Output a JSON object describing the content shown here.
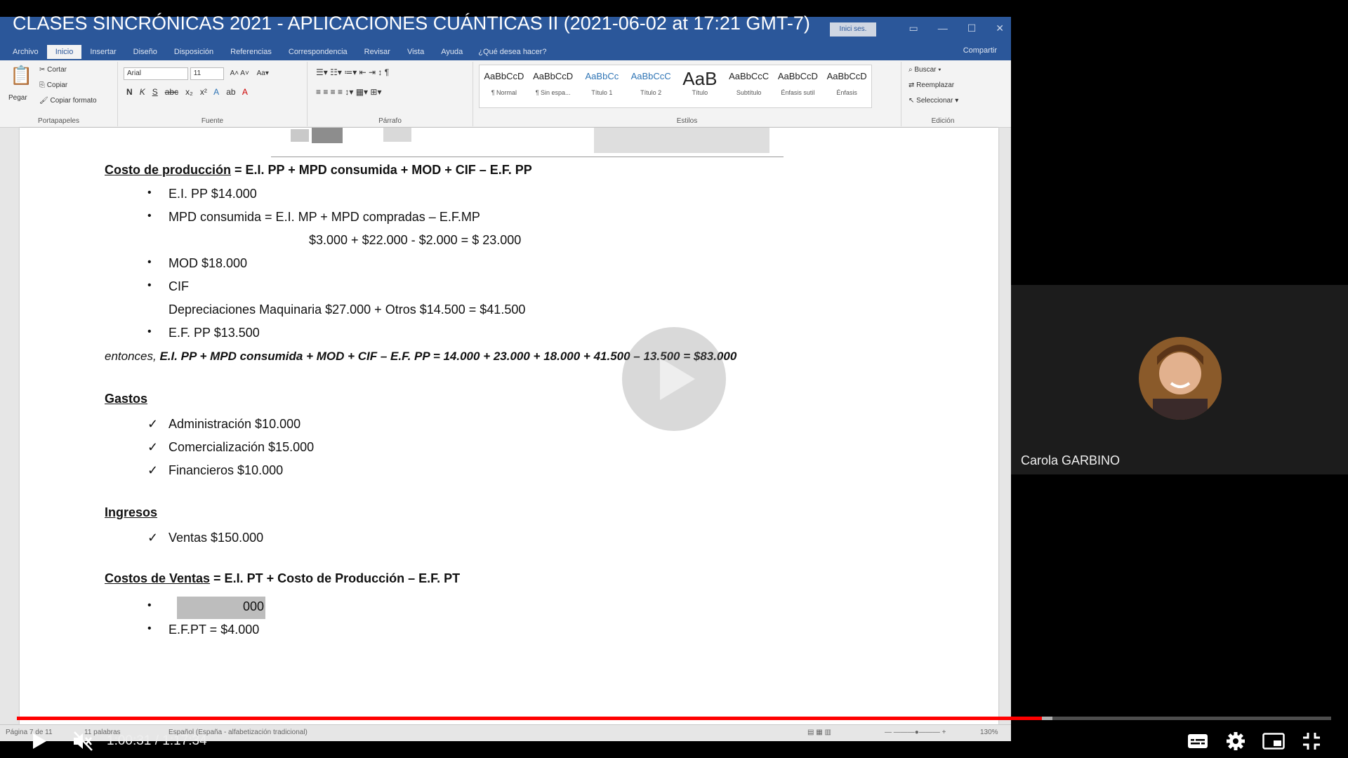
{
  "video": {
    "title": "CLASES SINCRÓNICAS 2021 - APLICACIONES CUÁNTICAS II (2021-06-02 at 17:21 GMT-7)",
    "time_current": "1:00:31",
    "time_separator": "/",
    "time_total": "1:17:34",
    "progress_fraction": 0.78,
    "buffer_fraction": 0.788,
    "accent_color": "#ff0000"
  },
  "participant": {
    "name": "Carola GARBINO"
  },
  "word": {
    "signin_label": "Inici ses.",
    "tabs": [
      "Archivo",
      "Inicio",
      "Insertar",
      "Diseño",
      "Disposición",
      "Referencias",
      "Correspondencia",
      "Revisar",
      "Vista",
      "Ayuda"
    ],
    "active_tab": "Inicio",
    "tellme": "¿Qué desea hacer?",
    "share": "Compartir",
    "clipboard": {
      "paste": "Pegar",
      "cut": "Cortar",
      "copy": "Copiar",
      "format": "Copiar formato",
      "group": "Portapapeles"
    },
    "font": {
      "name": "Arial",
      "size": "11",
      "group": "Fuente"
    },
    "paragraph_group": "Párrafo",
    "styles_group": "Estilos",
    "styles": [
      {
        "sample": "AaBbCcD",
        "name": "¶ Normal"
      },
      {
        "sample": "AaBbCcD",
        "name": "¶ Sin espa..."
      },
      {
        "sample": "AaBbCc",
        "name": "Título 1"
      },
      {
        "sample": "AaBbCcC",
        "name": "Título 2"
      },
      {
        "sample": "AaB",
        "name": "Título"
      },
      {
        "sample": "AaBbCcC",
        "name": "Subtítulo"
      },
      {
        "sample": "AaBbCcD",
        "name": "Énfasis sutil"
      },
      {
        "sample": "AaBbCcD",
        "name": "Énfasis"
      }
    ],
    "editing": {
      "find": "Buscar",
      "replace": "Reemplazar",
      "select": "Seleccionar",
      "group": "Edición"
    },
    "status": {
      "page": "Página 7 de 11",
      "words": "11 palabras",
      "language": "Español (España - alfabetización tradicional)",
      "zoom": "130%"
    }
  },
  "document": {
    "cost_heading_label": "Costo de producción",
    "cost_heading_rest": " = E.I. PP + MPD consumida + MOD + CIF – E.F. PP",
    "cost_items": {
      "ei": "E.I. PP $14.000",
      "mpd": "MPD consumida = E.I. MP + MPD compradas – E.F.MP",
      "mpd_calc": "$3.000 + $22.000 - $2.000 = $ 23.000",
      "mod": "MOD $18.000",
      "cif": "CIF",
      "cif_detail": "Depreciaciones Maquinaria $27.000 + Otros $14.500 = $41.500",
      "ef": "E.F. PP $13.500"
    },
    "conclusion_prefix": "entonces, ",
    "conclusion": "E.I. PP + MPD consumida + MOD + CIF – E.F. PP = 14.000 + 23.000 + 18.000 + 41.500 – 13.500 = $83.000",
    "gastos_heading": "Gastos",
    "gastos": [
      "Administración $10.000",
      "Comercialización $15.000",
      "Financieros $10.000"
    ],
    "ingresos_heading": "Ingresos",
    "ingresos": [
      "Ventas $150.000"
    ],
    "ventas_heading_label": "Costos de Ventas",
    "ventas_heading_rest": " = E.I. PT + Costo de Producción – E.F. PT",
    "ventas_items": [
      "000",
      "E.F.PT = $4.000"
    ]
  }
}
